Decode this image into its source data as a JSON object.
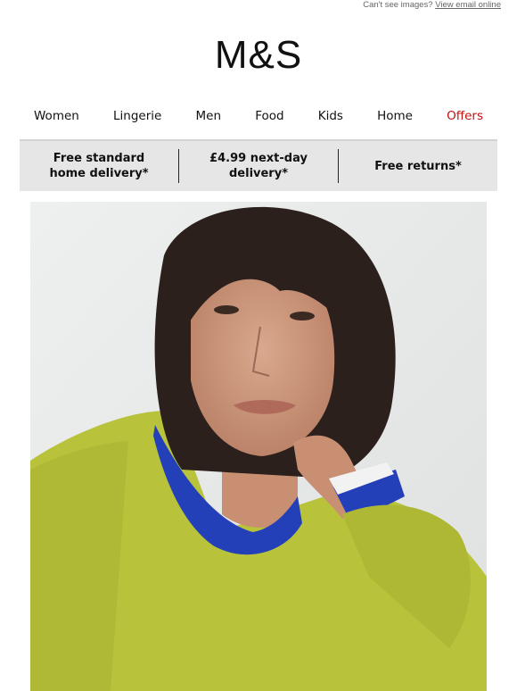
{
  "topbar": {
    "text": "Can't see images?",
    "link": "View email online"
  },
  "brand": {
    "logo": "M&S"
  },
  "nav": {
    "items": [
      "Women",
      "Lingerie",
      "Men",
      "Food",
      "Kids",
      "Home",
      "Offers"
    ]
  },
  "benefits": {
    "items": [
      {
        "line1": "Free standard",
        "line2": "home delivery*"
      },
      {
        "line1": "£4.99 next-day",
        "line2": "delivery*"
      },
      {
        "line1": "Free returns*",
        "line2": ""
      }
    ]
  },
  "colors": {
    "offers": "#c2120f",
    "benefits_bg": "#e6e6e6",
    "sweater": "#b9c23a",
    "inner_top": "#2440b8"
  },
  "hero": {
    "icon": "hero-photo"
  }
}
